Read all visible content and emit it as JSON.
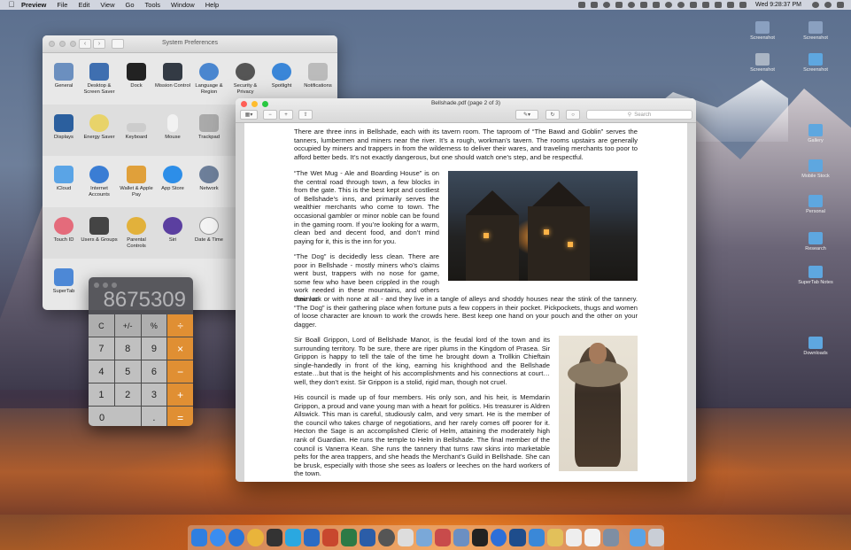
{
  "menubar": {
    "app": "Preview",
    "items": [
      "File",
      "Edit",
      "View",
      "Go",
      "Tools",
      "Window",
      "Help"
    ],
    "clock": "Wed 9:28:37 PM"
  },
  "system_preferences": {
    "title": "System Preferences",
    "rows": [
      [
        "General",
        "Desktop & Screen Saver",
        "Dock",
        "Mission Control",
        "Language & Region",
        "Security & Privacy",
        "Spotlight",
        "Notifications"
      ],
      [
        "Displays",
        "Energy Saver",
        "Keyboard",
        "Mouse",
        "Trackpad"
      ],
      [
        "iCloud",
        "Internet Accounts",
        "Wallet & Apple Pay",
        "App Store",
        "Network"
      ],
      [
        "Touch ID",
        "Users & Groups",
        "Parental Controls",
        "Siri",
        "Date & Time"
      ],
      [
        "SuperTab"
      ]
    ]
  },
  "calculator": {
    "display": "8675309",
    "keys": [
      "C",
      "+/-",
      "%",
      "÷",
      "7",
      "8",
      "9",
      "×",
      "4",
      "5",
      "6",
      "−",
      "1",
      "2",
      "3",
      "+",
      "0",
      ".",
      "="
    ]
  },
  "preview": {
    "title": "Bellshade.pdf (page 2 of 3)",
    "search_placeholder": "Search",
    "paragraphs": {
      "p1": "There are three inns in Bellshade, each with its tavern room.  The taproom of “The Bawd and Goblin” serves the tanners, lumbermen and miners near the river.  It’s a rough, workman’s tavern.  The rooms upstairs are generally occupied by miners and trappers in from the wilderness to deliver their wares, and traveling merchants too poor to afford better beds.  It’s not exactly dangerous, but one should watch one’s step, and be respectful.",
      "p2": "“The Wet Mug - Ale and Boarding House” is on the central road through town, a few blocks in from the gate.  This is the best kept and costliest of Bellshade’s inns, and primarily serves the wealthier merchants who come to town.  The occasional gambler or minor noble can be found in the gaming room.  If you’re looking for a warm, clean bed and decent food, and don’t mind paying for it, this is the inn for you.",
      "p3a": "“The Dog” is decidedly less clean.  There are poor in Bellshade - mostly miners who’s claims went bust, trappers with no nose for game, some few who have been crippled in the rough work needed in these mountains, and others down on",
      "p3b": "their luck or with none at all - and they live in a tangle of alleys and shoddy houses near the stink of the tannery.  “The Dog” is their gathering place when fortune puts a few coppers in their pocket.  Pickpockets, thugs and women of loose character are known to work the crowds here.  Best keep one hand on your pouch and the other on your dagger.",
      "p4": "Sir Boall Grippon, Lord of Bellshade Manor, is the feudal lord of the town and its surrounding territory.  To be sure, there are riper plums in the Kingdom of Prasea.  Sir Grippon is happy to tell the tale of the time he brought down a Trollkin Chieftain single-handedly in front of the king, earning his knighthood and the Bellshade estate…but that is the height of his accomplishments and his connections at court…well, they don’t exist.  Sir Grippon is a stolid, rigid man, though not cruel.",
      "p5": "His council is made up of four members.  His only son, and his heir, is Memdarin Grippon, a proud and vane young man with a heart for politics. His treasurer is Aldren Allswick.  This man is careful, studiously calm, and very smart.  He is the member of the council who takes charge of negotiations, and her rarely comes off poorer for it. Hecton the Sage is an accomplished Cleric of Helm, attaining the moderately high rank of Guardian.  He runs the temple to Helm in Bellshade. The final member of the council is Vanerra Kean.  She runs the tannery that turns raw skins into marketable pelts for the area trappers, and she heads the Merchant’s Guild in Bellshade.  She can be brusk, especially with those she sees as loafers or leeches on the hard workers of the town."
    }
  },
  "desktop_icons": [
    "Screenshot",
    "Screenshot",
    "Screenshot",
    "Screenshot",
    "Gallery",
    "Mobile Stock",
    "Personal",
    "Research",
    "SuperTab Notes",
    "Downloads"
  ]
}
